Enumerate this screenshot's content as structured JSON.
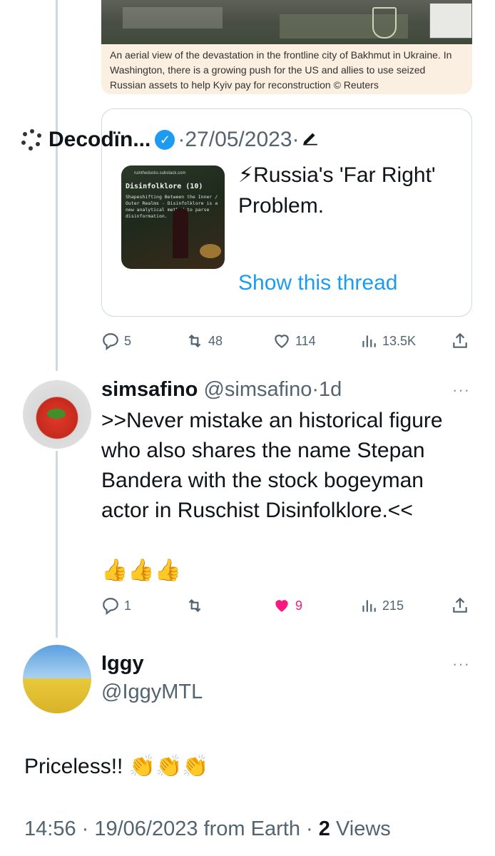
{
  "article_card": {
    "caption": "An aerial view of the devastation in the frontline city of Bakhmut in Ukraine. In Washington, there is a growing push for the US and allies to use seized Russian assets to help Kyiv pay for reconstruction © Reuters"
  },
  "quote_tweet": {
    "author": "Decodïn...",
    "separator": "·",
    "date": "27/05/2023",
    "thumb_url": "ruintheducks.substack.com",
    "thumb_title": "Disinfolklore (10)",
    "thumb_body": "Shapeshifting Between the Inner / Outer Realms - Disinfolklore is a new analytical method to parse disinformation.",
    "text": "⚡Russia's 'Far Right' Problem.",
    "show_thread": "Show this thread",
    "stats": {
      "replies": "5",
      "retweets": "48",
      "likes": "114",
      "views": "13.5K"
    }
  },
  "reply": {
    "name": "simsafino",
    "handle": "@simsafino",
    "time": "1d",
    "separator": "·",
    "text": ">>Never mistake an historical figure who also shares the name Stepan Bandera with the stock bogeyman actor in Ruschist Disinfolklore.<<",
    "emoji": "👍👍👍",
    "stats": {
      "replies": "1",
      "retweets": "",
      "likes": "9",
      "views": "215"
    },
    "liked": true
  },
  "main_tweet": {
    "name": "Iggy",
    "handle": "@IggyMTL",
    "text": "Priceless!! 👏👏👏",
    "time": "14:56",
    "date": "19/06/2023",
    "source": "from Earth",
    "views_count": "2",
    "views_label": "Views"
  },
  "colors": {
    "accent": "#1d9bf0",
    "like": "#f91880",
    "muted": "#536471",
    "caption_bg": "#fbefe2"
  }
}
